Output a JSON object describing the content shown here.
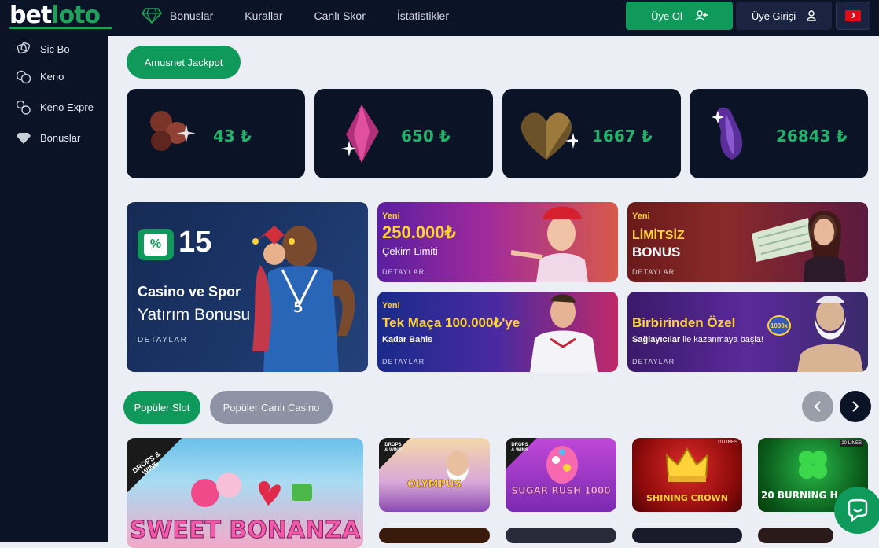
{
  "header": {
    "logo_part1": "bet",
    "logo_part2": "loto",
    "nav": [
      {
        "label": "Bonuslar",
        "icon": "diamond-icon"
      },
      {
        "label": "Kurallar"
      },
      {
        "label": "Canlı Skor"
      },
      {
        "label": "İstatistikler"
      }
    ],
    "register_label": "Üye Ol",
    "login_label": "Üye Girişi",
    "language_icon": "turkey-flag-icon"
  },
  "sidebar": {
    "items": [
      {
        "label": "Sic Bo",
        "icon": "dice-icon"
      },
      {
        "label": "Keno",
        "icon": "keno-balls-icon"
      },
      {
        "label": "Keno Expre",
        "icon": "keno-express-icon"
      },
      {
        "label": "Bonuslar",
        "icon": "diamond-icon"
      }
    ]
  },
  "jackpot": {
    "title": "Amusnet Jackpot",
    "cards": [
      {
        "value": "43 ₺",
        "suit": "club",
        "color": "#8a3d30"
      },
      {
        "value": "650 ₺",
        "suit": "diamond",
        "color": "#c23a8c"
      },
      {
        "value": "1667 ₺",
        "suit": "heart",
        "color": "#8a6a32"
      },
      {
        "value": "26843 ₺",
        "suit": "spade",
        "color": "#6b3fb0"
      }
    ]
  },
  "banners": {
    "main": {
      "number": "15",
      "percent": "%",
      "line1": "Casino ve Spor",
      "line2": "Yatırım Bonusu",
      "details": "DETAYLAR"
    },
    "b1": {
      "tag": "Yeni",
      "title": "250.000₺",
      "subtitle": "Çekim Limiti",
      "details": "DETAYLAR"
    },
    "b2": {
      "tag": "Yeni",
      "title1": "LİMİTSİZ",
      "title2": "BONUS",
      "details": "DETAYLAR"
    },
    "b3": {
      "tag": "Yeni",
      "title": "Tek Maça 100.000₺'ye",
      "subtitle": "Kadar Bahis",
      "details": "DETAYLAR"
    },
    "b4": {
      "title": "Birbirinden Özel",
      "subtitle_bold": "Sağlayıcılar",
      "subtitle_rest": " ile kazanmaya başla!",
      "details": "DETAYLAR",
      "badge": "1000x"
    }
  },
  "games_section": {
    "tab_active": "Popüler Slot",
    "tab_inactive": "Popüler Canlı Casino",
    "prev_icon": "chevron-left-icon",
    "next_icon": "chevron-right-icon",
    "games": [
      {
        "title": "SWEET BONANZA",
        "badge": "DROPS & WINS"
      },
      {
        "title": "OLYMPUS",
        "badge": "DROPS & WINS"
      },
      {
        "title": "SUGAR RUSH 1000",
        "badge": "DROPS & WINS"
      },
      {
        "title": "SHINING CROWN",
        "badge": "10 LINES"
      },
      {
        "title": "20 BURNING H",
        "badge": "20 LINES"
      }
    ]
  },
  "chat_icon": "chat-bubble-icon"
}
